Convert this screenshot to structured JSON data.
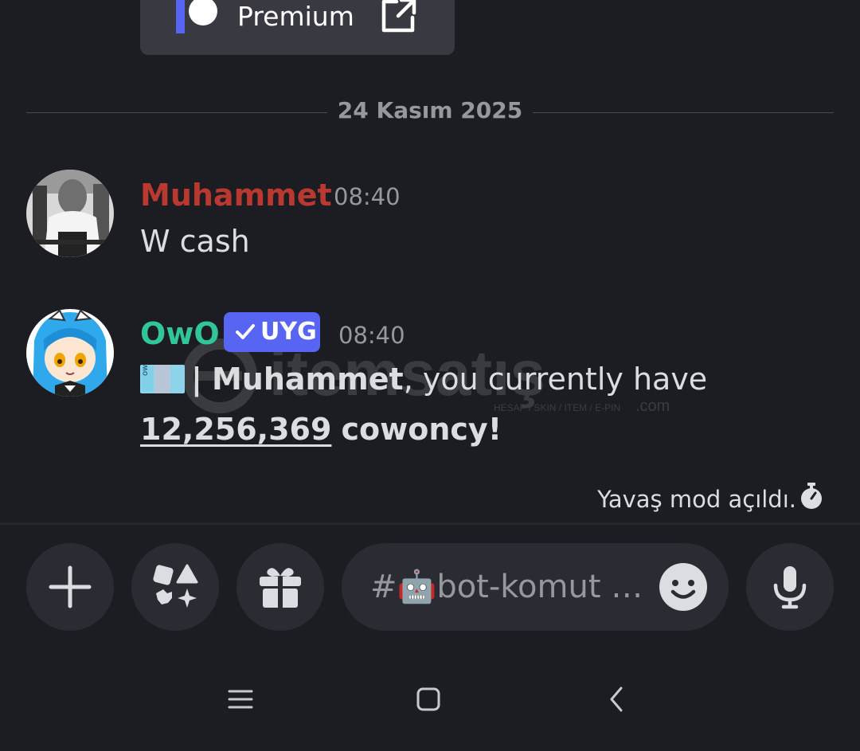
{
  "premium_card": {
    "label": "Premium"
  },
  "date_divider": {
    "text": "24 Kasım 2025"
  },
  "messages": [
    {
      "username": "Muhammet",
      "username_color": "#b9382f",
      "timestamp": "08:40",
      "content": "W cash"
    },
    {
      "username": "OwO",
      "username_color": "#30c69a",
      "badge": "UYG",
      "timestamp": "08:40",
      "content": {
        "separator": "|",
        "mention": "Muhammet",
        "text_1": ", you currently have",
        "amount": "12,256,369",
        "currency": "cowoncy!"
      }
    }
  ],
  "watermark": {
    "brand": "itemsatış",
    "tagline": "HESAP / SKIN / ITEM / E-PIN",
    "suffix": ".com"
  },
  "slow_mode": {
    "text": "Yavaş mod açıldı."
  },
  "composer": {
    "placeholder": "#🤖bot-komut …"
  },
  "colors": {
    "accent": "#5865f2",
    "background": "#1c1d22",
    "surface": "#2b2c33"
  },
  "icons": [
    "external-link-icon",
    "plus-icon",
    "apps-icon",
    "gift-icon",
    "emoji-icon",
    "microphone-icon",
    "stopwatch-icon",
    "menu-icon",
    "home-icon",
    "back-icon"
  ]
}
